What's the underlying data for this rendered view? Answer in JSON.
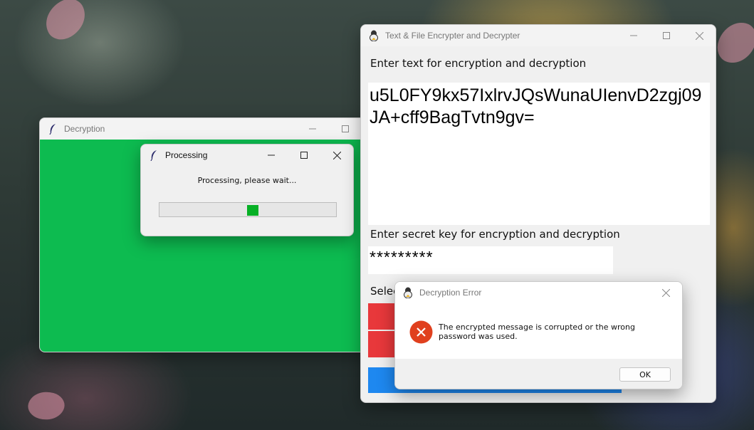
{
  "desktop": {
    "accent_color": "#d6ac4a"
  },
  "decryption_window": {
    "title": "Decryption",
    "background_color": "#0dbb50",
    "icon": "feather-icon"
  },
  "processing_dialog": {
    "title": "Processing",
    "message": "Processing, please wait...",
    "icon": "feather-icon",
    "progress_fraction": 0.53,
    "progress_color": "#06b025"
  },
  "main_window": {
    "title": "Text & File Encrypter and Decrypter",
    "icon": "app-icon",
    "text_label": "Enter text for encryption and decryption",
    "text_value": "u5L0FY9kx57IxlrvJQsWunaUIenvD2zgj09JA+cff9BagTvtn9gv=",
    "key_label": "Enter secret key for encryption and decryption",
    "key_value": "*********",
    "select_label": "Selec",
    "button_colors": {
      "red": "#e8383b",
      "blue": "#1e88f0"
    }
  },
  "error_dialog": {
    "title": "Decryption Error",
    "message": "The encrypted message is corrupted or the wrong password was used.",
    "ok_label": "OK",
    "icon": "error-icon",
    "error_color": "#e0401e"
  }
}
